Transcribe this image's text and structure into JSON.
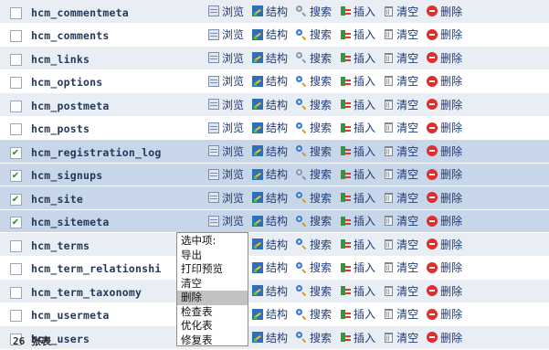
{
  "action_labels": {
    "browse": "浏览",
    "structure": "结构",
    "search": "搜索",
    "insert": "插入",
    "empty": "清空",
    "drop": "删除"
  },
  "tables": [
    {
      "name": "hcm_commentmeta",
      "checked": false,
      "shade": "light",
      "search_icon": "grey"
    },
    {
      "name": "hcm_comments",
      "checked": false,
      "shade": "white",
      "search_icon": "color"
    },
    {
      "name": "hcm_links",
      "checked": false,
      "shade": "light",
      "search_icon": "grey"
    },
    {
      "name": "hcm_options",
      "checked": false,
      "shade": "white",
      "search_icon": "color"
    },
    {
      "name": "hcm_postmeta",
      "checked": false,
      "shade": "light",
      "search_icon": "color"
    },
    {
      "name": "hcm_posts",
      "checked": false,
      "shade": "white",
      "search_icon": "color"
    },
    {
      "name": "hcm_registration_log",
      "checked": true,
      "shade": "marked",
      "search_icon": "color"
    },
    {
      "name": "hcm_signups",
      "checked": true,
      "shade": "marked",
      "search_icon": "grey"
    },
    {
      "name": "hcm_site",
      "checked": true,
      "shade": "marked",
      "search_icon": "color"
    },
    {
      "name": "hcm_sitemeta",
      "checked": true,
      "shade": "marked",
      "search_icon": "color"
    },
    {
      "name": "hcm_terms",
      "checked": false,
      "shade": "light",
      "search_icon": "color"
    },
    {
      "name": "hcm_term_relationshi",
      "checked": false,
      "shade": "white",
      "search_icon": "color"
    },
    {
      "name": "hcm_term_taxonomy",
      "checked": false,
      "shade": "light",
      "search_icon": "color"
    },
    {
      "name": "hcm_usermeta",
      "checked": false,
      "shade": "white",
      "search_icon": "color"
    },
    {
      "name": "hcm_users",
      "checked": false,
      "shade": "light",
      "search_icon": "color"
    }
  ],
  "context_menu": {
    "header": "选中项:",
    "items": [
      "导出",
      "打印预览",
      "清空",
      "删除",
      "检查表",
      "优化表",
      "修复表"
    ],
    "highlighted_index": 3
  },
  "footer": {
    "summary": "26 张表"
  },
  "colors": {
    "row_light": "#e9eef4",
    "row_marked": "#c7d6e8",
    "link_text": "#1d3b78",
    "table_name": "#23395b"
  }
}
